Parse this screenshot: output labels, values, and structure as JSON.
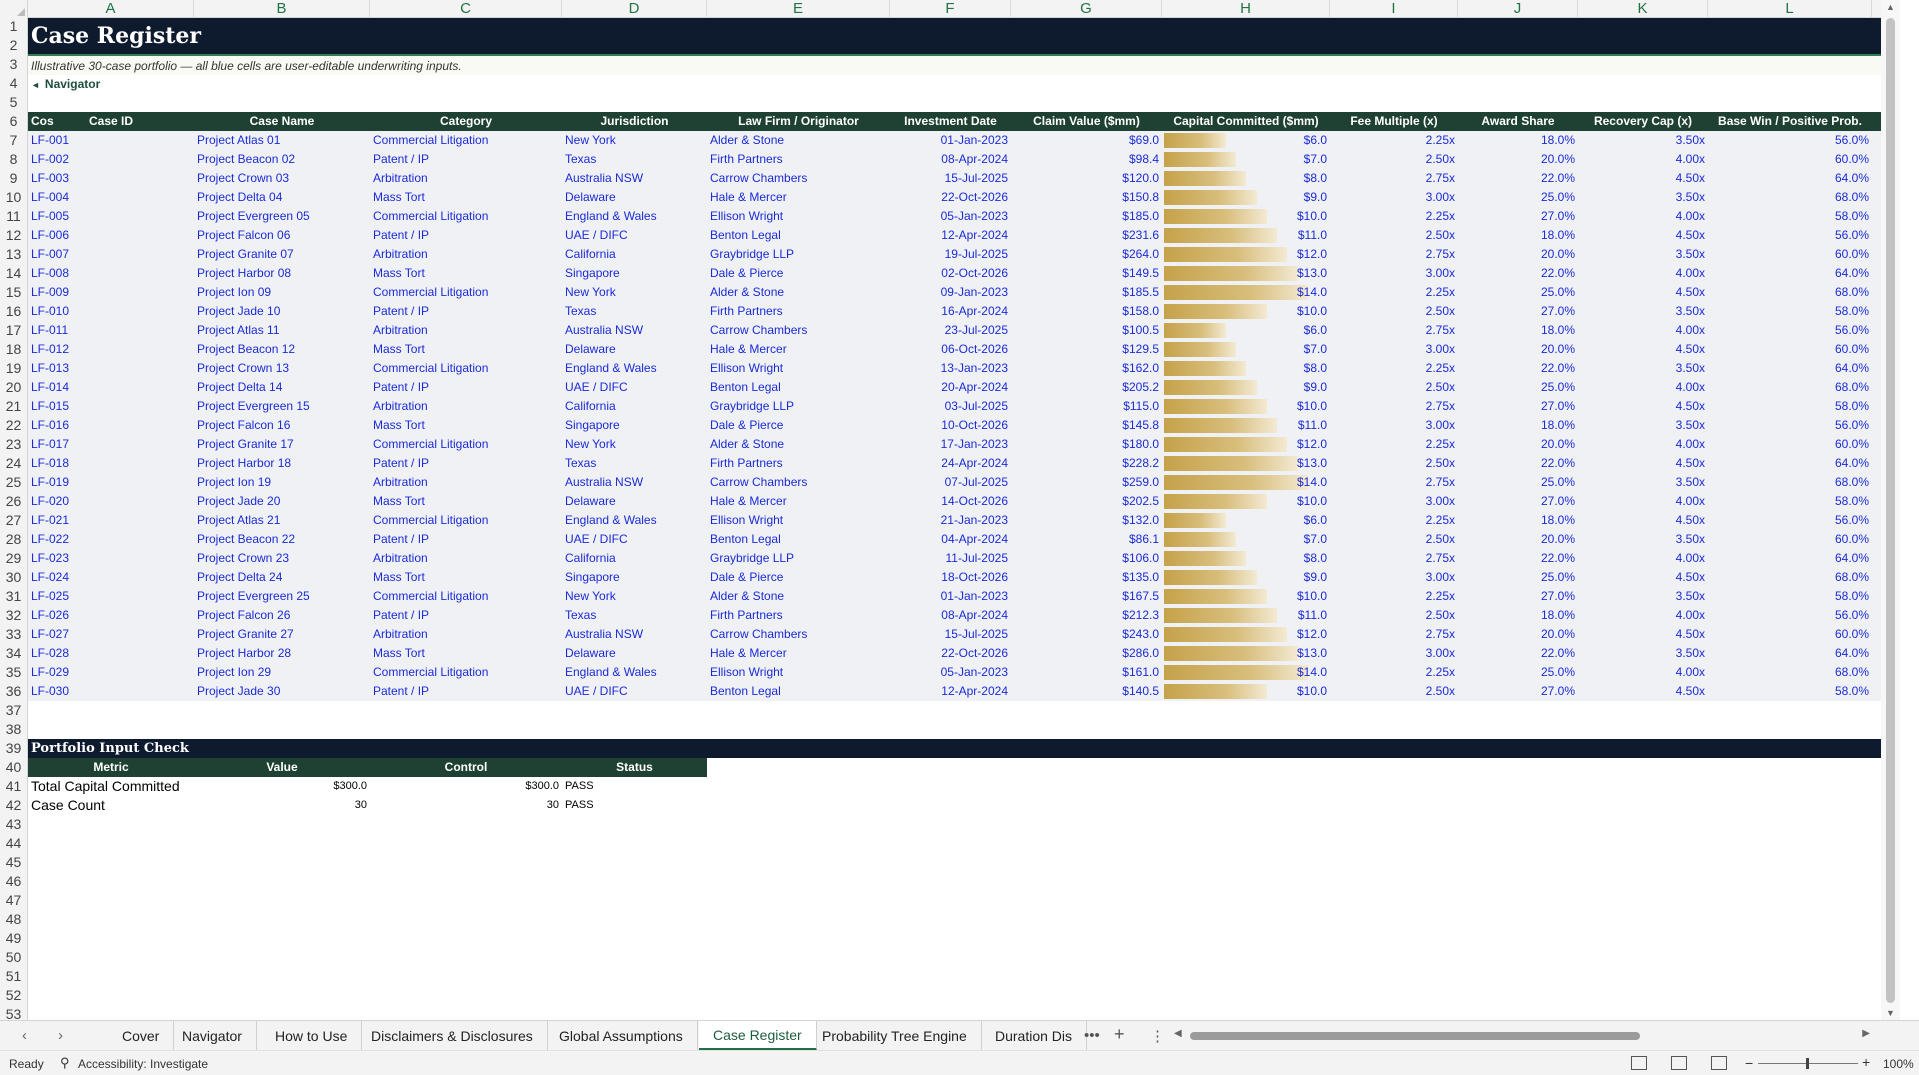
{
  "columns": [
    "A",
    "B",
    "C",
    "D",
    "E",
    "F",
    "G",
    "H",
    "I",
    "J",
    "K",
    "L"
  ],
  "row_numbers": [
    "1",
    "2",
    "3",
    "4",
    "5",
    "6",
    "7",
    "8",
    "9",
    "10",
    "11",
    "12",
    "13",
    "14",
    "15",
    "16",
    "17",
    "18",
    "19",
    "20",
    "21",
    "22",
    "23",
    "24",
    "25",
    "26",
    "27",
    "28",
    "29",
    "30",
    "31",
    "32",
    "33",
    "34",
    "35",
    "36",
    "37",
    "38",
    "39",
    "40",
    "41",
    "42",
    "43",
    "44",
    "45",
    "46",
    "47",
    "48",
    "49",
    "50",
    "51",
    "52",
    "53"
  ],
  "sheet": {
    "title": "Case Register",
    "subtitle": "Illustrative 30-case portfolio — all blue cells are user-editable underwriting inputs.",
    "nav_label": "Navigator",
    "headers": [
      "Case ID",
      "Case Name",
      "Category",
      "Jurisdiction",
      "Law Firm / Originator",
      "Investment Date",
      "Claim Value ($mm)",
      "Capital Committed ($mm)",
      "Fee Multiple (x)",
      "Award Share",
      "Recovery Cap (x)",
      "Base Win / Positive Prob.",
      "Cos"
    ],
    "rows": [
      {
        "id": "LF-001",
        "name": "Project Atlas 01",
        "category": "Commercial Litigation",
        "jurisdiction": "New York",
        "firm": "Alder & Stone",
        "date": "01-Jan-2023",
        "claim": "$69.0",
        "capital": "$6.0",
        "capital_num": 6,
        "fee": "2.25x",
        "award": "18.0%",
        "cap": "3.50x",
        "prob": "56.0%"
      },
      {
        "id": "LF-002",
        "name": "Project Beacon 02",
        "category": "Patent / IP",
        "jurisdiction": "Texas",
        "firm": "Firth Partners",
        "date": "08-Apr-2024",
        "claim": "$98.4",
        "capital": "$7.0",
        "capital_num": 7,
        "fee": "2.50x",
        "award": "20.0%",
        "cap": "4.00x",
        "prob": "60.0%"
      },
      {
        "id": "LF-003",
        "name": "Project Crown 03",
        "category": "Arbitration",
        "jurisdiction": "Australia NSW",
        "firm": "Carrow Chambers",
        "date": "15-Jul-2025",
        "claim": "$120.0",
        "capital": "$8.0",
        "capital_num": 8,
        "fee": "2.75x",
        "award": "22.0%",
        "cap": "4.50x",
        "prob": "64.0%"
      },
      {
        "id": "LF-004",
        "name": "Project Delta 04",
        "category": "Mass Tort",
        "jurisdiction": "Delaware",
        "firm": "Hale & Mercer",
        "date": "22-Oct-2026",
        "claim": "$150.8",
        "capital": "$9.0",
        "capital_num": 9,
        "fee": "3.00x",
        "award": "25.0%",
        "cap": "3.50x",
        "prob": "68.0%"
      },
      {
        "id": "LF-005",
        "name": "Project Evergreen 05",
        "category": "Commercial Litigation",
        "jurisdiction": "England & Wales",
        "firm": "Ellison Wright",
        "date": "05-Jan-2023",
        "claim": "$185.0",
        "capital": "$10.0",
        "capital_num": 10,
        "fee": "2.25x",
        "award": "27.0%",
        "cap": "4.00x",
        "prob": "58.0%"
      },
      {
        "id": "LF-006",
        "name": "Project Falcon 06",
        "category": "Patent / IP",
        "jurisdiction": "UAE / DIFC",
        "firm": "Benton Legal",
        "date": "12-Apr-2024",
        "claim": "$231.6",
        "capital": "$11.0",
        "capital_num": 11,
        "fee": "2.50x",
        "award": "18.0%",
        "cap": "4.50x",
        "prob": "56.0%"
      },
      {
        "id": "LF-007",
        "name": "Project Granite 07",
        "category": "Arbitration",
        "jurisdiction": "California",
        "firm": "Graybridge LLP",
        "date": "19-Jul-2025",
        "claim": "$264.0",
        "capital": "$12.0",
        "capital_num": 12,
        "fee": "2.75x",
        "award": "20.0%",
        "cap": "3.50x",
        "prob": "60.0%"
      },
      {
        "id": "LF-008",
        "name": "Project Harbor 08",
        "category": "Mass Tort",
        "jurisdiction": "Singapore",
        "firm": "Dale & Pierce",
        "date": "02-Oct-2026",
        "claim": "$149.5",
        "capital": "$13.0",
        "capital_num": 13,
        "fee": "3.00x",
        "award": "22.0%",
        "cap": "4.00x",
        "prob": "64.0%"
      },
      {
        "id": "LF-009",
        "name": "Project Ion 09",
        "category": "Commercial Litigation",
        "jurisdiction": "New York",
        "firm": "Alder & Stone",
        "date": "09-Jan-2023",
        "claim": "$185.5",
        "capital": "$14.0",
        "capital_num": 14,
        "fee": "2.25x",
        "award": "25.0%",
        "cap": "4.50x",
        "prob": "68.0%"
      },
      {
        "id": "LF-010",
        "name": "Project Jade 10",
        "category": "Patent / IP",
        "jurisdiction": "Texas",
        "firm": "Firth Partners",
        "date": "16-Apr-2024",
        "claim": "$158.0",
        "capital": "$10.0",
        "capital_num": 10,
        "fee": "2.50x",
        "award": "27.0%",
        "cap": "3.50x",
        "prob": "58.0%"
      },
      {
        "id": "LF-011",
        "name": "Project Atlas 11",
        "category": "Arbitration",
        "jurisdiction": "Australia NSW",
        "firm": "Carrow Chambers",
        "date": "23-Jul-2025",
        "claim": "$100.5",
        "capital": "$6.0",
        "capital_num": 6,
        "fee": "2.75x",
        "award": "18.0%",
        "cap": "4.00x",
        "prob": "56.0%"
      },
      {
        "id": "LF-012",
        "name": "Project Beacon 12",
        "category": "Mass Tort",
        "jurisdiction": "Delaware",
        "firm": "Hale & Mercer",
        "date": "06-Oct-2026",
        "claim": "$129.5",
        "capital": "$7.0",
        "capital_num": 7,
        "fee": "3.00x",
        "award": "20.0%",
        "cap": "4.50x",
        "prob": "60.0%"
      },
      {
        "id": "LF-013",
        "name": "Project Crown 13",
        "category": "Commercial Litigation",
        "jurisdiction": "England & Wales",
        "firm": "Ellison Wright",
        "date": "13-Jan-2023",
        "claim": "$162.0",
        "capital": "$8.0",
        "capital_num": 8,
        "fee": "2.25x",
        "award": "22.0%",
        "cap": "3.50x",
        "prob": "64.0%"
      },
      {
        "id": "LF-014",
        "name": "Project Delta 14",
        "category": "Patent / IP",
        "jurisdiction": "UAE / DIFC",
        "firm": "Benton Legal",
        "date": "20-Apr-2024",
        "claim": "$205.2",
        "capital": "$9.0",
        "capital_num": 9,
        "fee": "2.50x",
        "award": "25.0%",
        "cap": "4.00x",
        "prob": "68.0%"
      },
      {
        "id": "LF-015",
        "name": "Project Evergreen 15",
        "category": "Arbitration",
        "jurisdiction": "California",
        "firm": "Graybridge LLP",
        "date": "03-Jul-2025",
        "claim": "$115.0",
        "capital": "$10.0",
        "capital_num": 10,
        "fee": "2.75x",
        "award": "27.0%",
        "cap": "4.50x",
        "prob": "58.0%"
      },
      {
        "id": "LF-016",
        "name": "Project Falcon 16",
        "category": "Mass Tort",
        "jurisdiction": "Singapore",
        "firm": "Dale & Pierce",
        "date": "10-Oct-2026",
        "claim": "$145.8",
        "capital": "$11.0",
        "capital_num": 11,
        "fee": "3.00x",
        "award": "18.0%",
        "cap": "3.50x",
        "prob": "56.0%"
      },
      {
        "id": "LF-017",
        "name": "Project Granite 17",
        "category": "Commercial Litigation",
        "jurisdiction": "New York",
        "firm": "Alder & Stone",
        "date": "17-Jan-2023",
        "claim": "$180.0",
        "capital": "$12.0",
        "capital_num": 12,
        "fee": "2.25x",
        "award": "20.0%",
        "cap": "4.00x",
        "prob": "60.0%"
      },
      {
        "id": "LF-018",
        "name": "Project Harbor 18",
        "category": "Patent / IP",
        "jurisdiction": "Texas",
        "firm": "Firth Partners",
        "date": "24-Apr-2024",
        "claim": "$228.2",
        "capital": "$13.0",
        "capital_num": 13,
        "fee": "2.50x",
        "award": "22.0%",
        "cap": "4.50x",
        "prob": "64.0%"
      },
      {
        "id": "LF-019",
        "name": "Project Ion 19",
        "category": "Arbitration",
        "jurisdiction": "Australia NSW",
        "firm": "Carrow Chambers",
        "date": "07-Jul-2025",
        "claim": "$259.0",
        "capital": "$14.0",
        "capital_num": 14,
        "fee": "2.75x",
        "award": "25.0%",
        "cap": "3.50x",
        "prob": "68.0%"
      },
      {
        "id": "LF-020",
        "name": "Project Jade 20",
        "category": "Mass Tort",
        "jurisdiction": "Delaware",
        "firm": "Hale & Mercer",
        "date": "14-Oct-2026",
        "claim": "$202.5",
        "capital": "$10.0",
        "capital_num": 10,
        "fee": "3.00x",
        "award": "27.0%",
        "cap": "4.00x",
        "prob": "58.0%"
      },
      {
        "id": "LF-021",
        "name": "Project Atlas 21",
        "category": "Commercial Litigation",
        "jurisdiction": "England & Wales",
        "firm": "Ellison Wright",
        "date": "21-Jan-2023",
        "claim": "$132.0",
        "capital": "$6.0",
        "capital_num": 6,
        "fee": "2.25x",
        "award": "18.0%",
        "cap": "4.50x",
        "prob": "56.0%"
      },
      {
        "id": "LF-022",
        "name": "Project Beacon 22",
        "category": "Patent / IP",
        "jurisdiction": "UAE / DIFC",
        "firm": "Benton Legal",
        "date": "04-Apr-2024",
        "claim": "$86.1",
        "capital": "$7.0",
        "capital_num": 7,
        "fee": "2.50x",
        "award": "20.0%",
        "cap": "3.50x",
        "prob": "60.0%"
      },
      {
        "id": "LF-023",
        "name": "Project Crown 23",
        "category": "Arbitration",
        "jurisdiction": "California",
        "firm": "Graybridge LLP",
        "date": "11-Jul-2025",
        "claim": "$106.0",
        "capital": "$8.0",
        "capital_num": 8,
        "fee": "2.75x",
        "award": "22.0%",
        "cap": "4.00x",
        "prob": "64.0%"
      },
      {
        "id": "LF-024",
        "name": "Project Delta 24",
        "category": "Mass Tort",
        "jurisdiction": "Singapore",
        "firm": "Dale & Pierce",
        "date": "18-Oct-2026",
        "claim": "$135.0",
        "capital": "$9.0",
        "capital_num": 9,
        "fee": "3.00x",
        "award": "25.0%",
        "cap": "4.50x",
        "prob": "68.0%"
      },
      {
        "id": "LF-025",
        "name": "Project Evergreen 25",
        "category": "Commercial Litigation",
        "jurisdiction": "New York",
        "firm": "Alder & Stone",
        "date": "01-Jan-2023",
        "claim": "$167.5",
        "capital": "$10.0",
        "capital_num": 10,
        "fee": "2.25x",
        "award": "27.0%",
        "cap": "3.50x",
        "prob": "58.0%"
      },
      {
        "id": "LF-026",
        "name": "Project Falcon 26",
        "category": "Patent / IP",
        "jurisdiction": "Texas",
        "firm": "Firth Partners",
        "date": "08-Apr-2024",
        "claim": "$212.3",
        "capital": "$11.0",
        "capital_num": 11,
        "fee": "2.50x",
        "award": "18.0%",
        "cap": "4.00x",
        "prob": "56.0%"
      },
      {
        "id": "LF-027",
        "name": "Project Granite 27",
        "category": "Arbitration",
        "jurisdiction": "Australia NSW",
        "firm": "Carrow Chambers",
        "date": "15-Jul-2025",
        "claim": "$243.0",
        "capital": "$12.0",
        "capital_num": 12,
        "fee": "2.75x",
        "award": "20.0%",
        "cap": "4.50x",
        "prob": "60.0%"
      },
      {
        "id": "LF-028",
        "name": "Project Harbor 28",
        "category": "Mass Tort",
        "jurisdiction": "Delaware",
        "firm": "Hale & Mercer",
        "date": "22-Oct-2026",
        "claim": "$286.0",
        "capital": "$13.0",
        "capital_num": 13,
        "fee": "3.00x",
        "award": "22.0%",
        "cap": "3.50x",
        "prob": "64.0%"
      },
      {
        "id": "LF-029",
        "name": "Project Ion 29",
        "category": "Commercial Litigation",
        "jurisdiction": "England & Wales",
        "firm": "Ellison Wright",
        "date": "05-Jan-2023",
        "claim": "$161.0",
        "capital": "$14.0",
        "capital_num": 14,
        "fee": "2.25x",
        "award": "25.0%",
        "cap": "4.00x",
        "prob": "68.0%"
      },
      {
        "id": "LF-030",
        "name": "Project Jade 30",
        "category": "Patent / IP",
        "jurisdiction": "UAE / DIFC",
        "firm": "Benton Legal",
        "date": "12-Apr-2024",
        "claim": "$140.5",
        "capital": "$10.0",
        "capital_num": 10,
        "fee": "2.50x",
        "award": "27.0%",
        "cap": "4.50x",
        "prob": "58.0%"
      }
    ],
    "capital_bar_max": 14,
    "check": {
      "title": "Portfolio Input Check",
      "headers": [
        "Metric",
        "Value",
        "Control",
        "Status"
      ],
      "rows": [
        {
          "metric": "Total Capital Committed",
          "value": "$300.0",
          "control": "$300.0",
          "status": "PASS"
        },
        {
          "metric": "Case Count",
          "value": "30",
          "control": "30",
          "status": "PASS"
        }
      ]
    }
  },
  "tabs": {
    "prev_icon": "chevron-left-icon",
    "next_icon": "chevron-right-icon",
    "items": [
      "Cover",
      "Navigator",
      "How to Use",
      "Disclaimers & Disclosures",
      "Global Assumptions",
      "Case Register",
      "Probability Tree Engine",
      "Duration Dis"
    ],
    "active": "Case Register",
    "more": "•••",
    "add": "+"
  },
  "status": {
    "ready": "Ready",
    "accessibility": "Accessibility: Investigate",
    "zoom": "100%"
  },
  "colors": {
    "title_band": "#0e1b2e",
    "header_green": "#1e4133",
    "input_blue": "#1a2bd6",
    "bar_gold": "#c5a24a",
    "accent": "#217346"
  }
}
